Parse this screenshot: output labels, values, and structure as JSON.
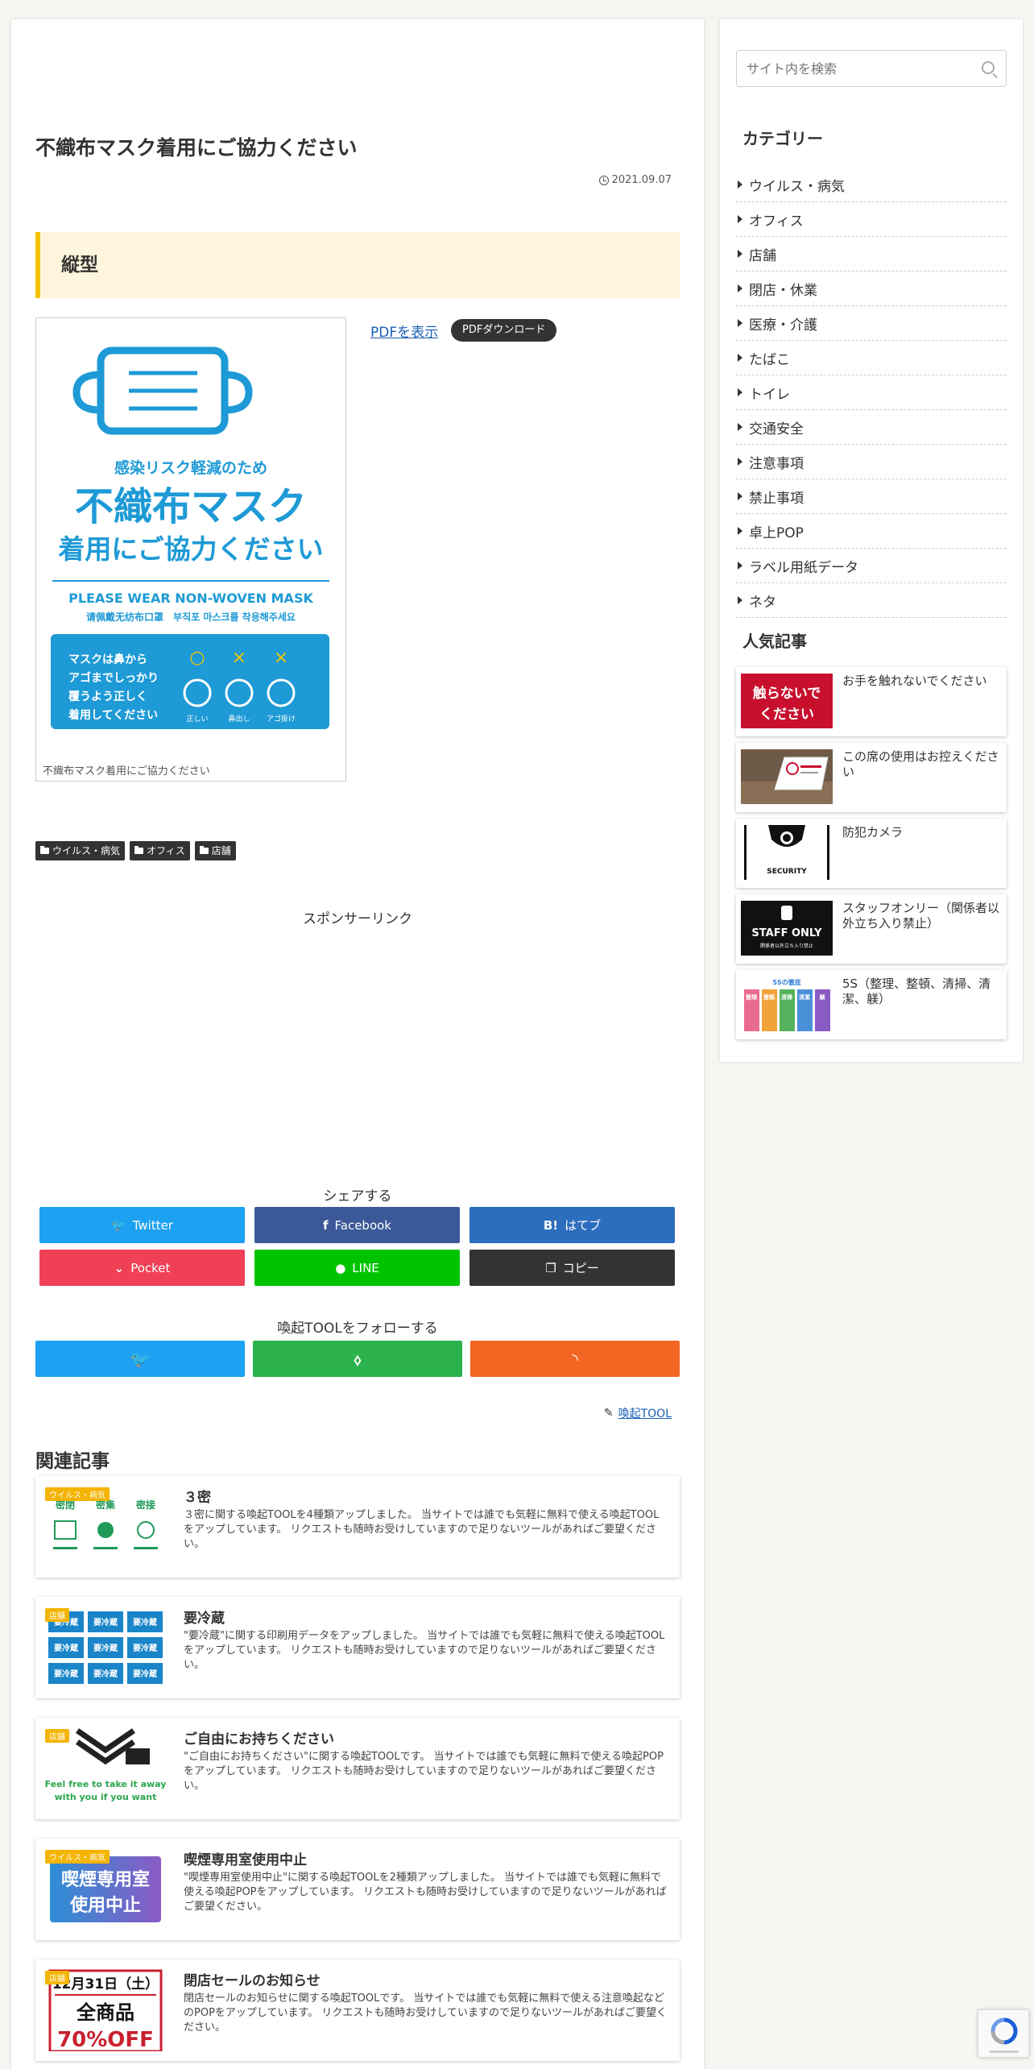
{
  "article": {
    "title": "不織布マスク着用にご協力ください",
    "date": "2021.09.07",
    "section_heading": "縦型",
    "figure": {
      "poster_lines": [
        "感染リスク軽減のため",
        "不織布マスク",
        "着用にご協力ください",
        "PLEASE WEAR NON-WOVEN MASK",
        "请佩戴无纺布口罩　부직포 마스크를 착용해주세요",
        "マスクは鼻から",
        "アゴまでしっかり",
        "覆うよう正しく",
        "着用してください"
      ],
      "poster_marks": [
        "○",
        "×",
        "×"
      ],
      "poster_mark_labels": [
        "正しい",
        "鼻出し",
        "アゴ掛け"
      ],
      "caption": "不織布マスク着用にご協力ください"
    },
    "pdf_link": "PDFを表示",
    "pdf_download": "PDFダウンロード",
    "tags": [
      "ウイルス・病気",
      "オフィス",
      "店舗"
    ],
    "sponsor_label": "スポンサーリンク",
    "share_title": "シェアする",
    "share_buttons": [
      {
        "label": "Twitter",
        "icon": "twitter-icon",
        "color": "#1da1f2"
      },
      {
        "label": "Facebook",
        "icon": "facebook-icon",
        "color": "#3b5998"
      },
      {
        "label": "はてブ",
        "icon": "hatena-icon",
        "color": "#2c6ebd"
      },
      {
        "label": "Pocket",
        "icon": "pocket-icon",
        "color": "#ef4056"
      },
      {
        "label": "LINE",
        "icon": "line-icon",
        "color": "#00c300"
      },
      {
        "label": "コピー",
        "icon": "copy-icon",
        "color": "#333333"
      }
    ],
    "follow_title": "喚起TOOLをフォローする",
    "follow_buttons": [
      {
        "icon": "twitter-icon",
        "color": "#1da1f2"
      },
      {
        "icon": "feedly-icon",
        "color": "#2bb24c"
      },
      {
        "icon": "rss-icon",
        "color": "#f26522"
      }
    ],
    "author": "喚起TOOL",
    "related_title": "関連記事",
    "related": [
      {
        "title": "３密",
        "category": "ウイルス・病気",
        "text": "３密に関する喚起TOOLを4種類アップしました。 当サイトでは誰でも気軽に無料で使える喚起TOOLをアップしています。 リクエストも随時お受けしていますので足りないツールがあればご要望ください。"
      },
      {
        "title": "要冷蔵",
        "category": "店舗",
        "text": "\"要冷蔵\"に関する印刷用データをアップしました。 当サイトでは誰でも気軽に無料で使える喚起TOOLをアップしています。 リクエストも随時お受けしていますので足りないツールがあればご要望ください。"
      },
      {
        "title": "ご自由にお持ちください",
        "category": "店舗",
        "text": "\"ご自由にお持ちください\"に関する喚起TOOLです。 当サイトでは誰でも気軽に無料で使える喚起POPをアップしています。 リクエストも随時お受けしていますので足りないツールがあればご要望ください。"
      },
      {
        "title": "喫煙専用室使用中止",
        "category": "ウイルス・病気",
        "text": "\"喫煙専用室使用中止\"に関する喚起TOOLを2種類アップしました。 当サイトでは誰でも気軽に無料で使える喚起POPをアップしています。 リクエストも随時お受けしていますので足りないツールがあればご要望ください。"
      },
      {
        "title": "閉店セールのお知らせ",
        "category": "店舗",
        "text": "閉店セールのお知らせに関する喚起TOOLです。 当サイトでは誰でも気軽に無料で使える注意喚起などのPOPをアップしています。 リクエストも随時お受けしていますので足りないツールがあればご要望ください。"
      }
    ],
    "related_thumb_text": {
      "r1": [
        "密閉",
        "密集",
        "密接"
      ],
      "r2": "要冷蔵",
      "r3": [
        "Feel free to take it away",
        "with you if you want"
      ],
      "r4": [
        "喫煙専用室",
        "使用中止"
      ],
      "r5": [
        "12月31日（土）",
        "全商品",
        "70%OFF"
      ]
    }
  },
  "sidebar": {
    "search_placeholder": "サイト内を検索",
    "category_heading": "カテゴリー",
    "categories": [
      "ウイルス・病気",
      "オフィス",
      "店舗",
      "閉店・休業",
      "医療・介護",
      "たばこ",
      "トイレ",
      "交通安全",
      "注意事項",
      "禁止事項",
      "卓上POP",
      "ラベル用紙データ",
      "ネタ"
    ],
    "popular_heading": "人気記事",
    "popular": [
      {
        "title": "お手を触れないでください",
        "thumb_text": [
          "触らないで",
          "ください"
        ]
      },
      {
        "title": "この席の使用はお控えください",
        "thumb_text": []
      },
      {
        "title": "防犯カメラ",
        "thumb_text": [
          "SECURITY"
        ]
      },
      {
        "title": "スタッフオンリー（関係者以外立ち入り禁止）",
        "thumb_text": [
          "STAFF ONLY",
          "関係者以外立ち入り禁止"
        ]
      },
      {
        "title": "5S（整理、整頓、清掃、清潔、躾）",
        "thumb_text": [
          "5Sの徹底",
          "整理",
          "整頓",
          "清掃",
          "清潔",
          "躾"
        ]
      }
    ]
  }
}
